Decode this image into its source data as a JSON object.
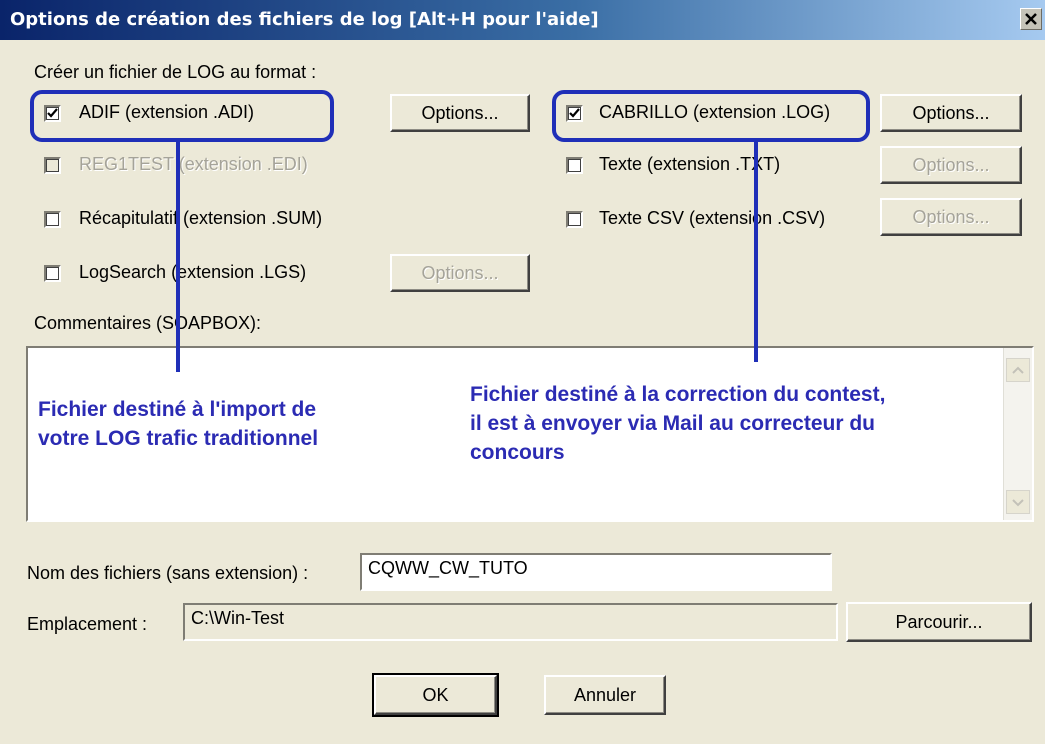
{
  "window": {
    "title": "Options de création des fichiers de log [Alt+H pour l'aide]"
  },
  "group_label": "Créer un fichier de LOG au format :",
  "formats": {
    "adif": {
      "label": "ADIF (extension .ADI)",
      "checked": true,
      "enabled": true
    },
    "reg1test": {
      "label": "REG1TEST (extension .EDI)",
      "checked": false,
      "enabled": false
    },
    "recap": {
      "label": "Récapitulatif (extension .SUM)",
      "checked": false,
      "enabled": true
    },
    "logsearch": {
      "label": "LogSearch (extension .LGS)",
      "checked": false,
      "enabled": true
    },
    "cabrillo": {
      "label": "CABRILLO (extension .LOG)",
      "checked": true,
      "enabled": true
    },
    "texte": {
      "label": "Texte (extension .TXT)",
      "checked": false,
      "enabled": true
    },
    "csv": {
      "label": "Texte CSV (extension .CSV)",
      "checked": false,
      "enabled": true
    }
  },
  "buttons": {
    "options": "Options...",
    "browse": "Parcourir...",
    "ok": "OK",
    "cancel": "Annuler"
  },
  "comments_label": "Commentaires (SOAPBOX):",
  "annotations": {
    "left": [
      "Fichier destiné à l'import de",
      "votre LOG trafic traditionnel"
    ],
    "right": [
      "Fichier destiné à la correction du contest,",
      "il est à envoyer via Mail au correcteur du",
      "concours"
    ]
  },
  "filename": {
    "label": "Nom des fichiers (sans extension) :",
    "value": "CQWW_CW_TUTO"
  },
  "location": {
    "label": "Emplacement :",
    "value": "C:\\Win-Test"
  },
  "colors": {
    "annotation": "#2b2bb3",
    "highlight": "#1f2fb8",
    "dialog_bg": "#ece9d8"
  }
}
